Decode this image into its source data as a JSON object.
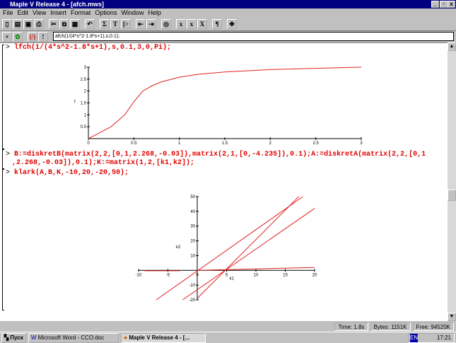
{
  "window": {
    "title": "Maple V Release 4 - [afch.mws]"
  },
  "menu": [
    "File",
    "Edit",
    "View",
    "Insert",
    "Format",
    "Options",
    "Window",
    "Help"
  ],
  "toolbar": {
    "icons": [
      "new-icon",
      "open-icon",
      "save-icon",
      "print-icon",
      "cut-icon",
      "copy-icon",
      "paste-icon",
      "undo-icon",
      "sigma-icon",
      "text-icon",
      "prompt-icon",
      "outdent-icon",
      "indent-icon",
      "stop-icon",
      "x-normal-icon",
      "x-italic-icon",
      "x-script-icon",
      "pilcrow-icon",
      "expand-icon"
    ],
    "glyphs": [
      "▯",
      "▤",
      "▣",
      "⎙",
      "✂",
      "⧉",
      "▦",
      "↶",
      "Σ",
      "T",
      "[>",
      "⇤",
      "⇥",
      "◎",
      "x",
      "x",
      "X",
      "¶",
      "✥"
    ]
  },
  "context": {
    "command": "afch(1/(4*s^2-1.8*s+1),s,0.1);"
  },
  "worksheet": {
    "inputs": [
      "lfch(1/(4*s^2-1.8*s+1),s,0.1,3,0,Pi);",
      "B:=diskretB(matrix(2,2,[0,1,2.268,-0.03]),matrix(2,1,[0,-4.235]),0.1);A:=diskretA(matrix(2,2,[0,1",
      "2.268,-0.03]),0.1);K:=matrix(1,2,[k1,k2]);",
      "klark(A,B,K,-10,20,-20,50);"
    ],
    "prompt": ">"
  },
  "chart_data": [
    {
      "type": "line",
      "xlabel": "",
      "ylabel": "f",
      "xlim": [
        0,
        3
      ],
      "ylim": [
        0,
        3
      ],
      "xticks": [
        "0",
        "0.5",
        "1",
        "1.5",
        "2",
        "2.5",
        "3"
      ],
      "yticks": [
        "0.5",
        "1",
        "1.5",
        "2",
        "2.5",
        "3"
      ],
      "color": "#e02020",
      "x": [
        0,
        0.1,
        0.25,
        0.4,
        0.5,
        0.6,
        0.7,
        0.8,
        1,
        1.2,
        1.5,
        2,
        2.5,
        3
      ],
      "y": [
        0,
        0.2,
        0.5,
        1,
        1.55,
        2,
        2.22,
        2.38,
        2.58,
        2.7,
        2.8,
        2.9,
        2.95,
        3
      ]
    },
    {
      "type": "line",
      "xlabel": "k1",
      "ylabel": "k2",
      "xlim": [
        -10,
        20
      ],
      "ylim": [
        -20,
        50
      ],
      "xticks": [
        "-10",
        "-5",
        "0",
        "5",
        "10",
        "15",
        "20"
      ],
      "yticks": [
        "-20",
        "-10",
        "10",
        "20",
        "30",
        "40",
        "50"
      ],
      "color": "#e02020",
      "series": [
        {
          "x": [
            -7,
            18
          ],
          "y": [
            -20,
            50
          ]
        },
        {
          "x": [
            -2.5,
            20
          ],
          "y": [
            -20,
            42
          ]
        },
        {
          "x": [
            0,
            17.3
          ],
          "y": [
            -19,
            50
          ]
        },
        {
          "x": [
            0,
            20
          ],
          "y": [
            0,
            2
          ]
        },
        {
          "x": [
            -9,
            -3
          ],
          "y": [
            -0.3,
            -0.3
          ]
        }
      ]
    }
  ],
  "status": {
    "time": "Time: 1.8s",
    "bytes": "Bytes: 1151K",
    "free": "Free: 94520K"
  },
  "taskbar": {
    "start": "Пуск",
    "tasks": [
      "Microsoft Word - CCO.doc",
      "Maple V Release 4 - [..."
    ],
    "clock": "17:21"
  }
}
